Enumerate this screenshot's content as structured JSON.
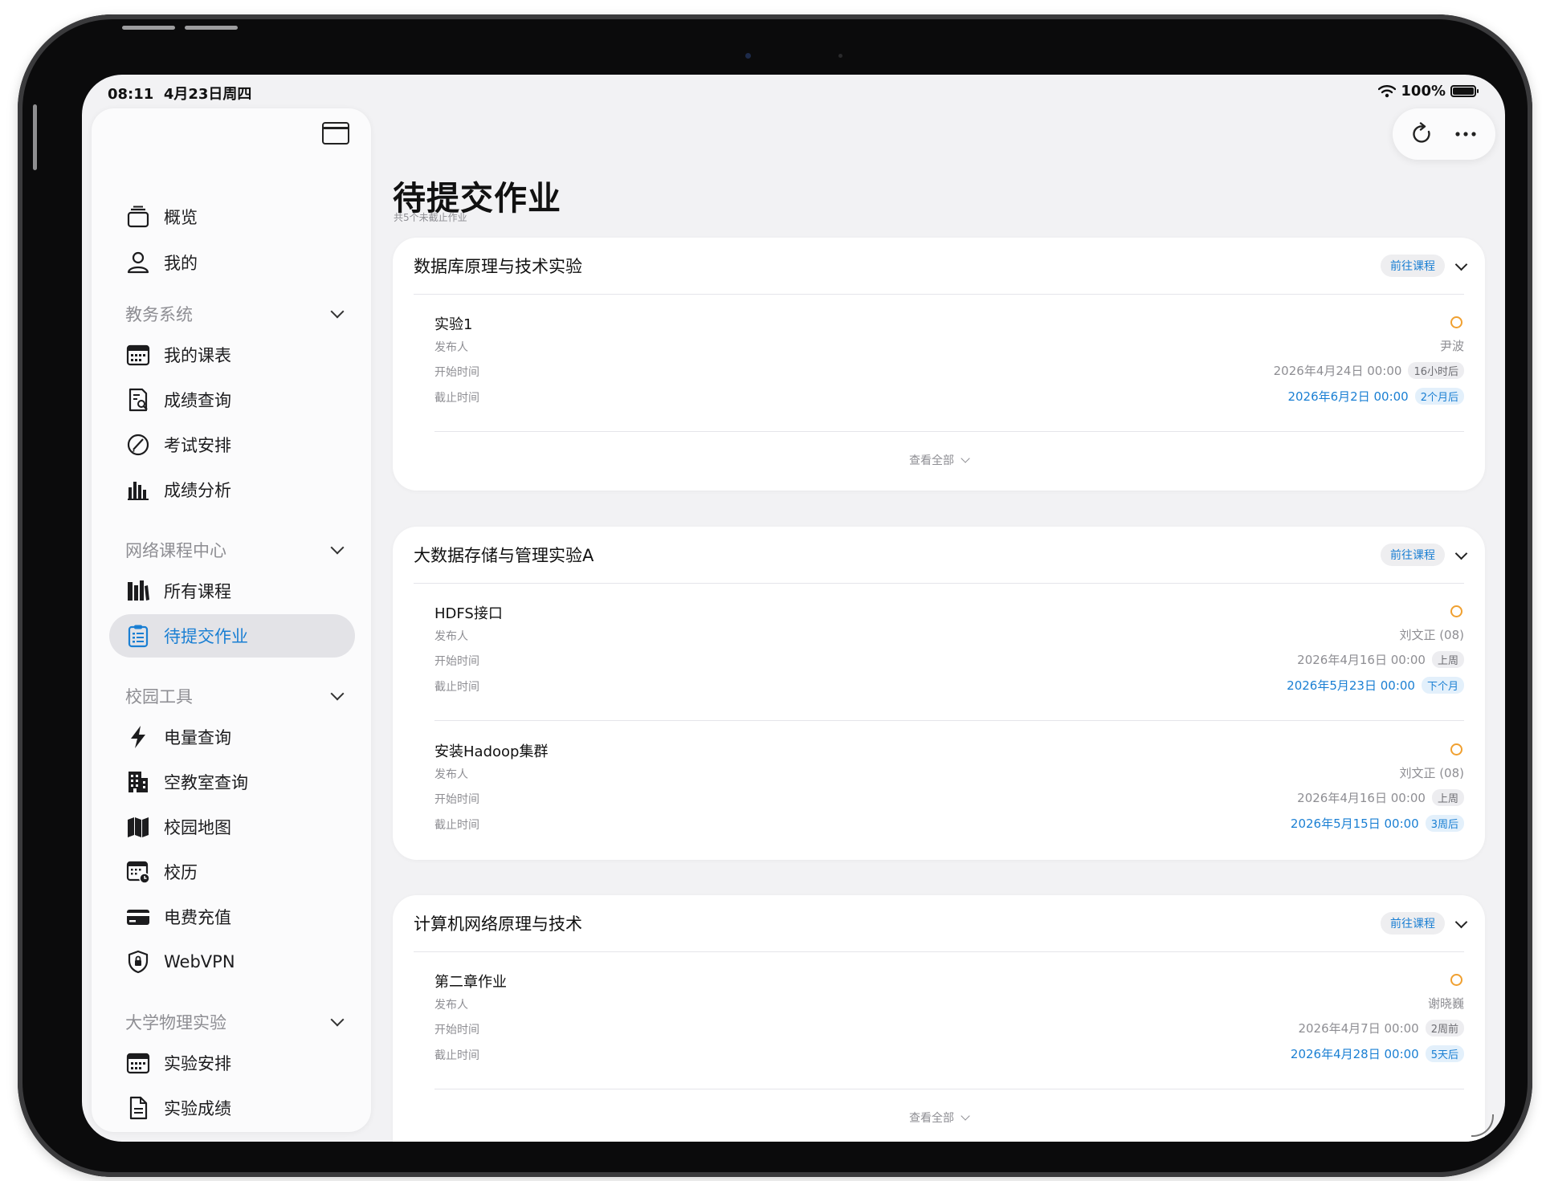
{
  "status_bar": {
    "time": "08:11",
    "date": "4月23日周四",
    "battery": "100%"
  },
  "sidebar": {
    "top_items": [
      {
        "label": "概览",
        "icon": "overview-icon"
      },
      {
        "label": "我的",
        "icon": "person-icon"
      }
    ],
    "sections": [
      {
        "title": "教务系统",
        "items": [
          {
            "label": "我的课表",
            "icon": "calendar-icon"
          },
          {
            "label": "成绩查询",
            "icon": "grade-search-icon"
          },
          {
            "label": "考试安排",
            "icon": "exam-icon"
          },
          {
            "label": "成绩分析",
            "icon": "bar-chart-icon"
          }
        ]
      },
      {
        "title": "网络课程中心",
        "items": [
          {
            "label": "所有课程",
            "icon": "books-icon"
          },
          {
            "label": "待提交作业",
            "icon": "clipboard-icon",
            "active": true
          }
        ]
      },
      {
        "title": "校园工具",
        "items": [
          {
            "label": "电量查询",
            "icon": "bolt-icon"
          },
          {
            "label": "空教室查询",
            "icon": "building-icon"
          },
          {
            "label": "校园地图",
            "icon": "map-icon"
          },
          {
            "label": "校历",
            "icon": "school-calendar-icon"
          },
          {
            "label": "电费充值",
            "icon": "card-icon"
          },
          {
            "label": "WebVPN",
            "icon": "shield-icon"
          }
        ]
      },
      {
        "title": "大学物理实验",
        "items": [
          {
            "label": "实验安排",
            "icon": "calendar-icon"
          },
          {
            "label": "实验成绩",
            "icon": "document-icon"
          }
        ]
      }
    ]
  },
  "toolbar": {
    "refresh_icon": "refresh-icon",
    "more_icon": "more-icon"
  },
  "main": {
    "title": "待提交作业",
    "subtitle": "共5个未截止作业",
    "go_course_label": "前往课程",
    "view_all_label": "查看全部",
    "labels": {
      "publisher": "发布人",
      "start": "开始时间",
      "deadline": "截止时间"
    },
    "courses": [
      {
        "name": "数据库原理与技术实验",
        "assignments": [
          {
            "title": "实验1",
            "publisher": "尹波",
            "start": "2026年4月24日 00:00",
            "start_rel": "16小时后",
            "deadline": "2026年6月2日 00:00",
            "deadline_rel": "2个月后"
          }
        ]
      },
      {
        "name": "大数据存储与管理实验A",
        "assignments": [
          {
            "title": "HDFS接口",
            "publisher": "刘文正 (08)",
            "start": "2026年4月16日 00:00",
            "start_rel": "上周",
            "deadline": "2026年5月23日 00:00",
            "deadline_rel": "下个月"
          },
          {
            "title": "安装Hadoop集群",
            "publisher": "刘文正 (08)",
            "start": "2026年4月16日 00:00",
            "start_rel": "上周",
            "deadline": "2026年5月15日 00:00",
            "deadline_rel": "3周后"
          }
        ]
      },
      {
        "name": "计算机网络原理与技术",
        "assignments": [
          {
            "title": "第二章作业",
            "publisher": "谢晓巍",
            "start": "2026年4月7日 00:00",
            "start_rel": "2周前",
            "deadline": "2026年4月28日 00:00",
            "deadline_rel": "5天后"
          }
        ]
      }
    ]
  }
}
